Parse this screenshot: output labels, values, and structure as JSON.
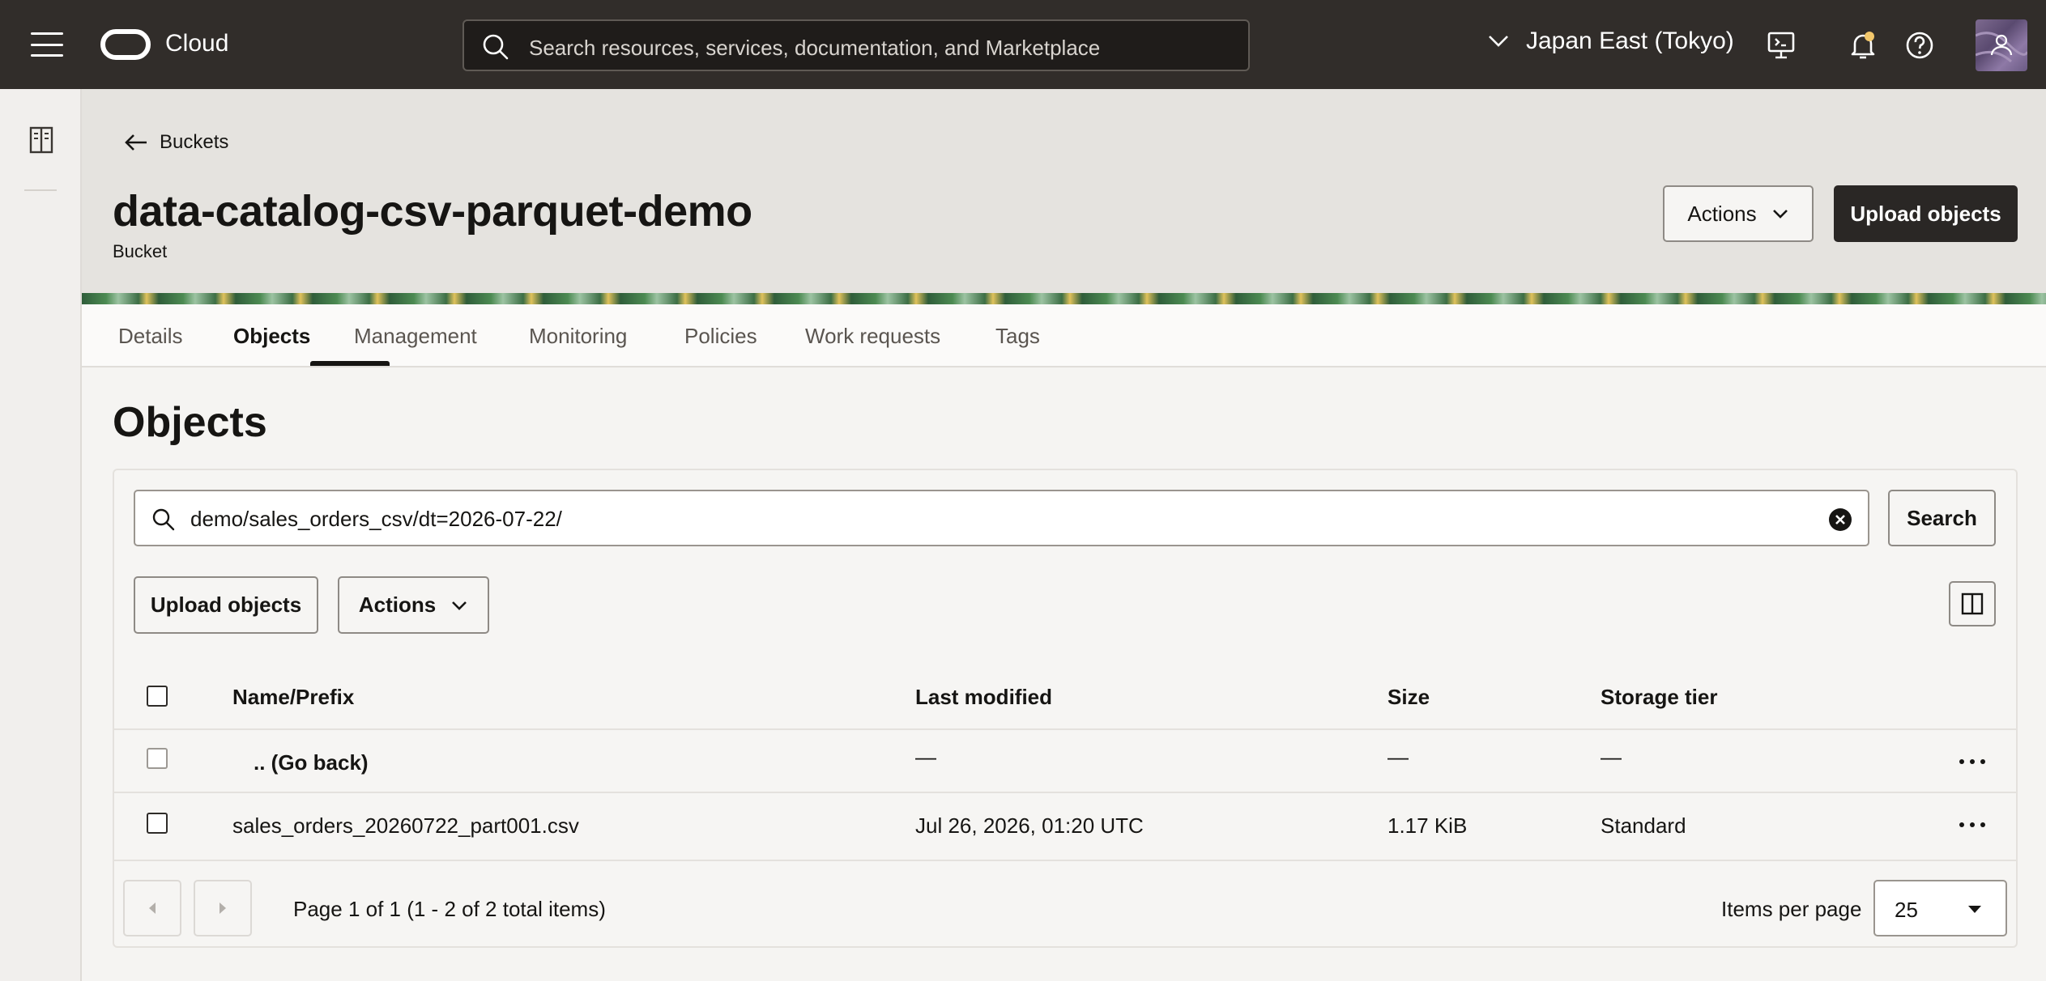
{
  "topbar": {
    "brand": "Cloud",
    "search_placeholder": "Search resources, services, documentation, and Marketplace",
    "region": "Japan East (Tokyo)"
  },
  "header": {
    "back_label": "Buckets",
    "title": "data-catalog-csv-parquet-demo",
    "subtitle": "Bucket",
    "actions_label": "Actions",
    "upload_label": "Upload objects"
  },
  "tabs": [
    "Details",
    "Objects",
    "Management",
    "Monitoring",
    "Policies",
    "Work requests",
    "Tags"
  ],
  "objects": {
    "title": "Objects",
    "search_value": "demo/sales_orders_csv/dt=2026-07-22/",
    "search_button": "Search",
    "upload_label": "Upload objects",
    "actions_label": "Actions",
    "columns": [
      "Name/Prefix",
      "Last modified",
      "Size",
      "Storage tier"
    ],
    "rows": [
      {
        "name": ".. (Go back)",
        "modified": "—",
        "size": "—",
        "tier": "—"
      },
      {
        "name": "sales_orders_20260722_part001.csv",
        "modified": "Jul 26, 2026, 01:20 UTC",
        "size": "1.17 KiB",
        "tier": "Standard"
      }
    ]
  },
  "pagination": {
    "summary": "Page 1 of 1 (1 - 2 of 2 total items)",
    "items_per_page_label": "Items per page",
    "items_per_page": "25"
  },
  "colors": {
    "topbar": "#312d2a",
    "header_bg": "#e5e3df",
    "primary_button": "#2a2725"
  }
}
